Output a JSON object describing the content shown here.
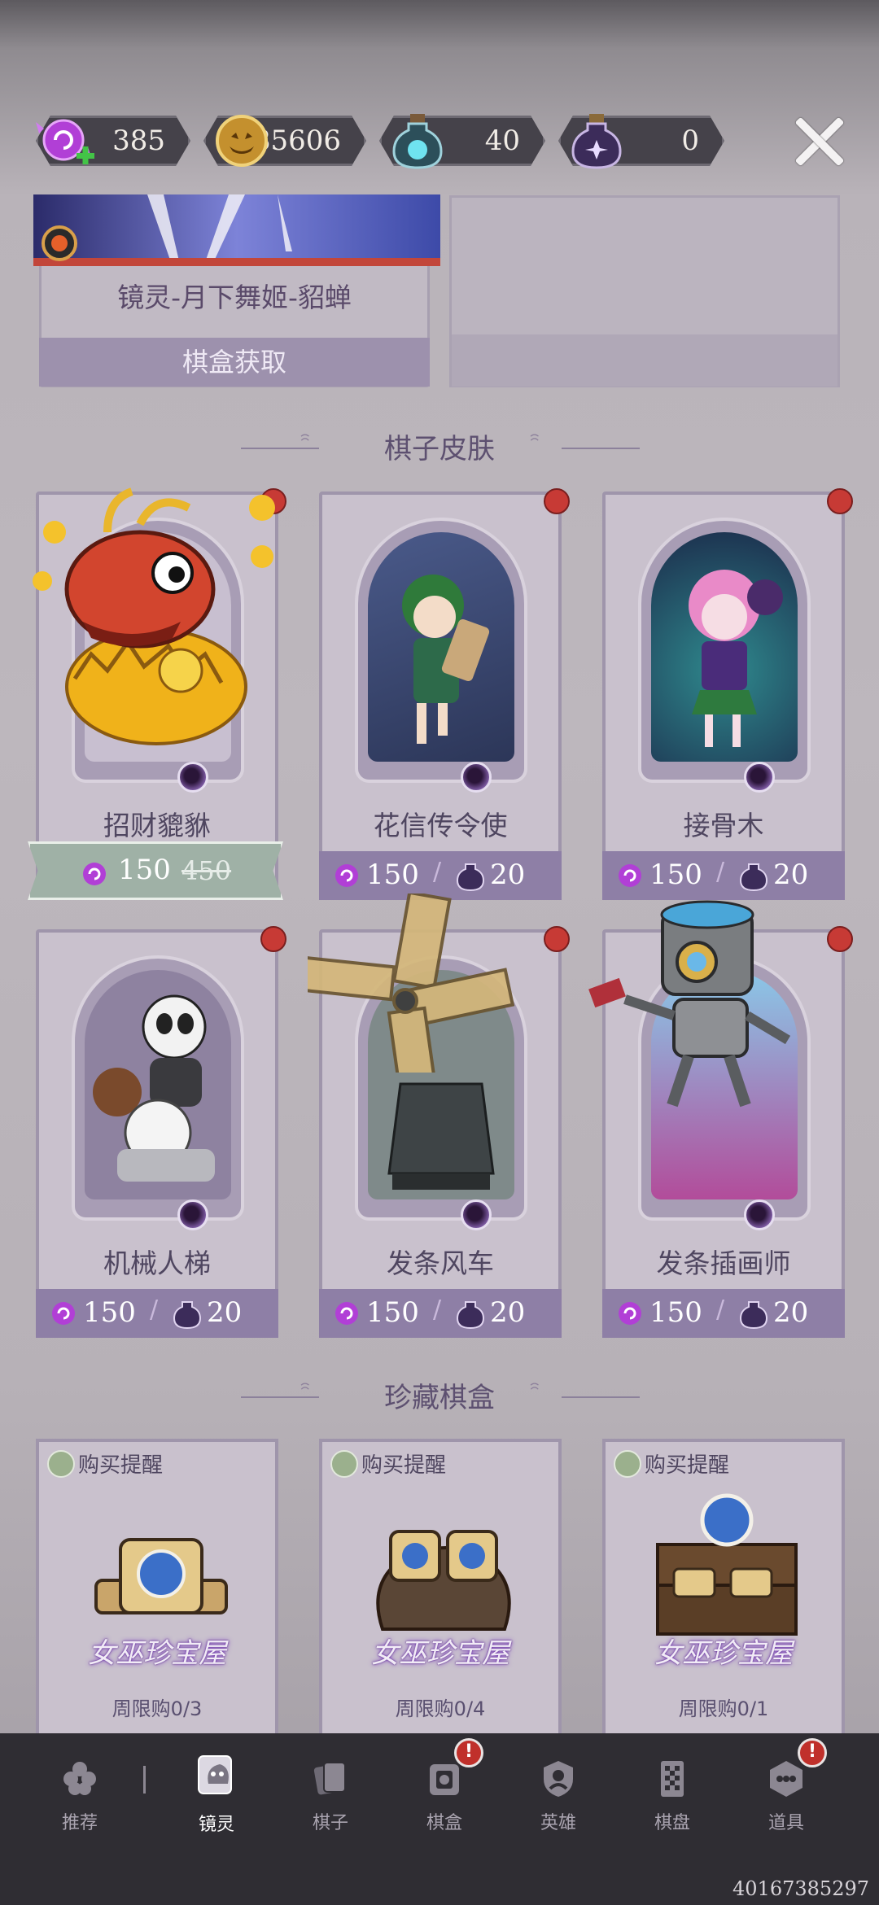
{
  "currency": [
    {
      "name": "candy",
      "value": "385"
    },
    {
      "name": "pumpkin-coin",
      "value": "85606"
    },
    {
      "name": "blue-potion",
      "value": "40"
    },
    {
      "name": "purple-potion",
      "value": "0"
    }
  ],
  "top_card": {
    "name": "镜灵-月下舞姬-貂蝉",
    "source": "棋盒获取"
  },
  "sections": {
    "skins": "棋子皮肤",
    "boxes": "珍藏棋盒"
  },
  "skins": [
    {
      "name": "招财貔貅",
      "sale_price": "150",
      "original_price": "450"
    },
    {
      "name": "花信传令使",
      "price_candy": "150",
      "price_potion": "20",
      "separator": "/"
    },
    {
      "name": "接骨木",
      "price_candy": "150",
      "price_potion": "20",
      "separator": "/"
    },
    {
      "name": "机械人梯",
      "price_candy": "150",
      "price_potion": "20",
      "separator": "/"
    },
    {
      "name": "发条风车",
      "price_candy": "150",
      "price_potion": "20",
      "separator": "/"
    },
    {
      "name": "发条插画师",
      "price_candy": "150",
      "price_potion": "20",
      "separator": "/"
    }
  ],
  "boxes": [
    {
      "remind": "购买提醒",
      "brand": "女巫珍宝屋",
      "limit": "周限购0/3"
    },
    {
      "remind": "购买提醒",
      "brand": "女巫珍宝屋",
      "limit": "周限购0/4"
    },
    {
      "remind": "购买提醒",
      "brand": "女巫珍宝屋",
      "limit": "周限购0/1"
    }
  ],
  "nav": [
    {
      "label": "推荐",
      "icon": "flower-icon"
    },
    {
      "label": "镜灵",
      "icon": "mirror-spirit-icon",
      "active": true
    },
    {
      "label": "棋子",
      "icon": "cards-icon"
    },
    {
      "label": "棋盒",
      "icon": "chess-box-icon",
      "alert": "!"
    },
    {
      "label": "英雄",
      "icon": "hero-icon"
    },
    {
      "label": "棋盘",
      "icon": "board-icon"
    },
    {
      "label": "道具",
      "icon": "item-icon",
      "alert": "!"
    }
  ],
  "uid": "40167385297",
  "colors": {
    "alert_red": "#c0302b",
    "price_bar": "#8e7fa6",
    "nav_bg": "#2f2d33"
  }
}
